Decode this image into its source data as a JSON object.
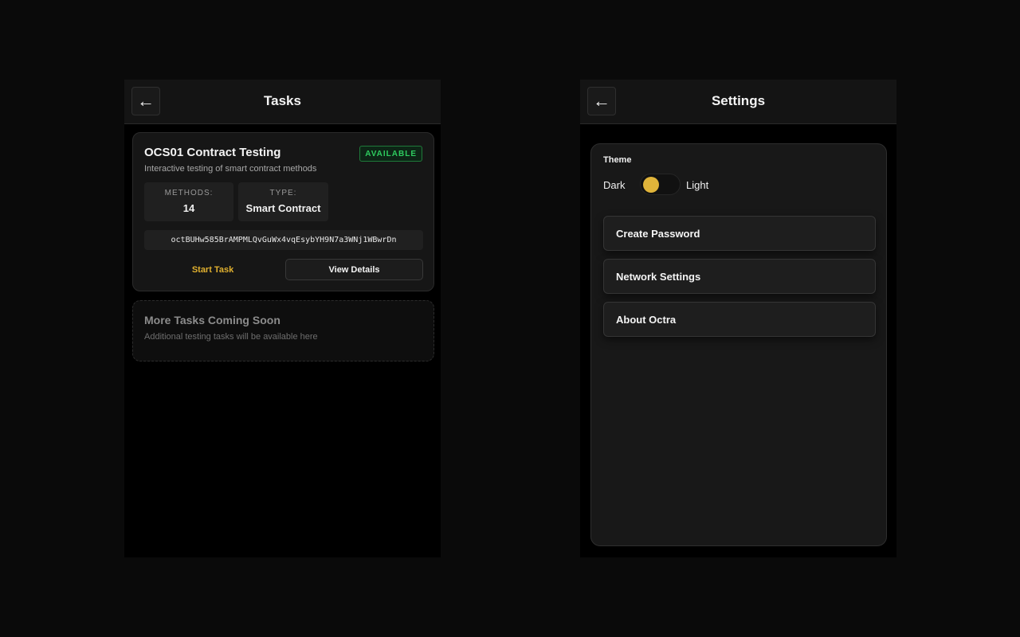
{
  "tasks_panel": {
    "header": {
      "back_icon": "left-arrow-icon",
      "back_glyph": "←",
      "title": "Tasks"
    },
    "task": {
      "title": "OCS01 Contract Testing",
      "status_badge": "AVAILABLE",
      "description": "Interactive testing of smart contract methods",
      "methods_label": "METHODS:",
      "methods_value": "14",
      "type_label": "TYPE:",
      "type_value": "Smart Contract",
      "address": "octBUHw585BrAMPMLQvGuWx4vqEsybYH9N7a3WNj1WBwrDn",
      "start_label": "Start Task",
      "details_label": "View Details"
    },
    "coming_soon": {
      "title": "More Tasks Coming Soon",
      "description": "Additional testing tasks will be available here"
    }
  },
  "settings_panel": {
    "header": {
      "back_icon": "left-arrow-icon",
      "back_glyph": "←",
      "title": "Settings"
    },
    "theme": {
      "label": "Theme",
      "dark_label": "Dark",
      "light_label": "Light",
      "current": "dark"
    },
    "buttons": [
      "Create Password",
      "Network Settings",
      "About Octra"
    ]
  },
  "colors": {
    "accent": "#e0b43a",
    "status_green": "#2ecc5f",
    "background": "#0a0a0a",
    "panel": "#000000",
    "card": "#161616"
  }
}
